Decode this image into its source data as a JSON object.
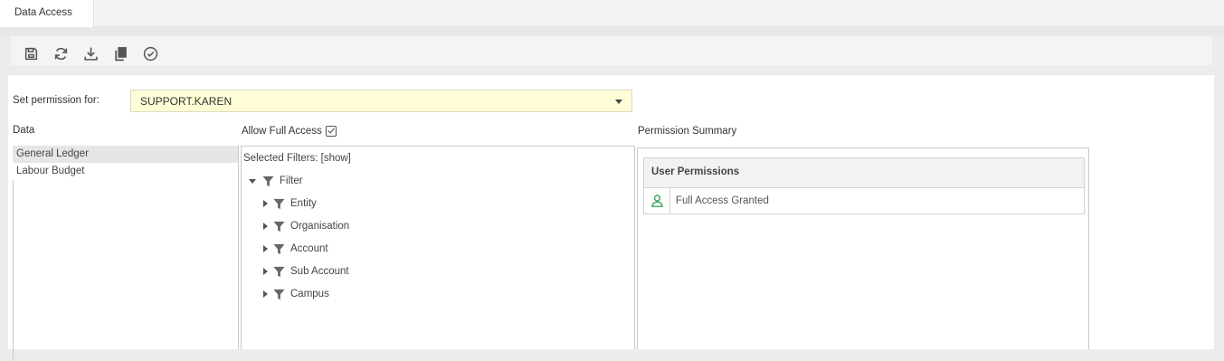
{
  "tabs": [
    {
      "label": "Data Access"
    }
  ],
  "toolbar": {
    "buttons": [
      {
        "icon": "save-icon"
      },
      {
        "icon": "refresh-icon"
      },
      {
        "icon": "download-icon"
      },
      {
        "icon": "copy-icon"
      },
      {
        "icon": "check-circle-icon"
      }
    ]
  },
  "permission": {
    "label": "Set permission for:",
    "selected_value": "SUPPORT.KAREN"
  },
  "data_panel": {
    "label": "Data",
    "items": [
      {
        "label": "General Ledger",
        "selected": true
      },
      {
        "label": "Labour Budget",
        "selected": false
      }
    ]
  },
  "filter_panel": {
    "allow_full_access_label": "Allow Full Access",
    "allow_full_access_checked": true,
    "selected_filters_text": "Selected Filters: [show]",
    "root": {
      "label": "Filter",
      "expanded": true
    },
    "children": [
      {
        "label": "Entity"
      },
      {
        "label": "Organisation"
      },
      {
        "label": "Account"
      },
      {
        "label": "Sub Account"
      },
      {
        "label": "Campus"
      }
    ]
  },
  "summary_panel": {
    "label": "Permission Summary",
    "table_header": "User Permissions",
    "rows": [
      {
        "icon": "user-icon",
        "text": "Full Access Granted"
      }
    ]
  },
  "colors": {
    "select_bg": "#fffdd6",
    "user_icon": "#3aa55d",
    "selected_row": "#e6e6e6"
  }
}
